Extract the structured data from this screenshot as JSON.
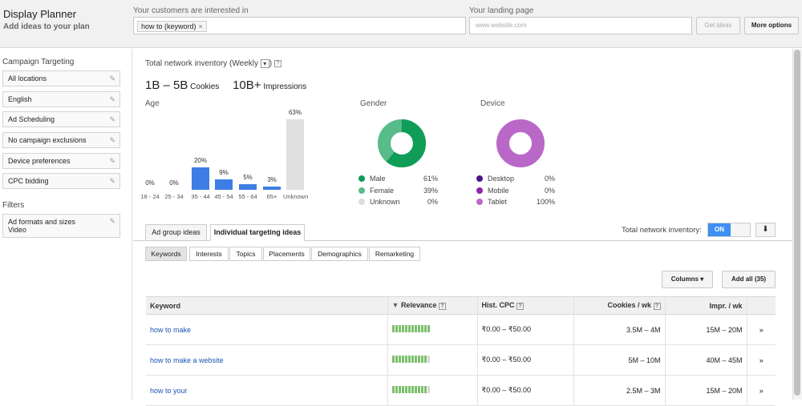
{
  "header": {
    "app_title": "Display Planner",
    "app_subtitle": "Add ideas to your plan",
    "customers_label": "Your customers are interested in",
    "keyword_chip": "how to (keyword)",
    "chip_close": "×",
    "landing_label": "Your landing page",
    "landing_placeholder": "www.website.com",
    "get_ideas": "Get ideas",
    "more_options": "More options"
  },
  "sidebar": {
    "targeting_title": "Campaign Targeting",
    "items": [
      {
        "label": "All locations"
      },
      {
        "label": "English"
      },
      {
        "label": "Ad Scheduling"
      },
      {
        "label": "No campaign exclusions"
      },
      {
        "label": "Device preferences"
      },
      {
        "label": "CPC bidding"
      }
    ],
    "filters_title": "Filters",
    "filter_item_1": "Ad formats and sizes",
    "filter_item_2": "Video"
  },
  "inventory": {
    "title": "Total network inventory (Weekly",
    "dropdown_glyph": "▾",
    "help": "?",
    "cookies_value": "1B – 5B",
    "cookies_label": "Cookies",
    "impressions_value": "10B+",
    "impressions_label": "Impressions"
  },
  "age": {
    "title": "Age",
    "bars": [
      {
        "label": "18 - 24",
        "pct": "0%",
        "value": 0
      },
      {
        "label": "25 - 34",
        "pct": "0%",
        "value": 0
      },
      {
        "label": "35 - 44",
        "pct": "20%",
        "value": 20
      },
      {
        "label": "45 - 54",
        "pct": "9%",
        "value": 9
      },
      {
        "label": "55 - 64",
        "pct": "5%",
        "value": 5
      },
      {
        "label": "65+",
        "pct": "3%",
        "value": 3
      },
      {
        "label": "Unknown",
        "pct": "63%",
        "value": 63
      }
    ]
  },
  "gender": {
    "title": "Gender",
    "items": [
      {
        "label": "Male",
        "pct": "61%",
        "color": "#0f9d58"
      },
      {
        "label": "Female",
        "pct": "39%",
        "color": "#57bb8a"
      },
      {
        "label": "Unknown",
        "pct": "0%",
        "color": "#dddddd"
      }
    ]
  },
  "device": {
    "title": "Device",
    "items": [
      {
        "label": "Desktop",
        "pct": "0%",
        "color": "#4a148c"
      },
      {
        "label": "Mobile",
        "pct": "0%",
        "color": "#8e24aa"
      },
      {
        "label": "Tablet",
        "pct": "100%",
        "color": "#ba68c8"
      }
    ]
  },
  "tabs": {
    "ad_group": "Ad group ideas",
    "individual": "Individual targeting ideas",
    "inventory_toggle_label": "Total network inventory:",
    "toggle_on": "ON",
    "download_glyph": "⬇"
  },
  "subtabs": [
    "Keywords",
    "Interests",
    "Topics",
    "Placements",
    "Demographics",
    "Remarketing"
  ],
  "table": {
    "columns_btn": "Columns ▾",
    "add_all_btn": "Add all (35)",
    "headers": {
      "keyword": "Keyword",
      "sort_glyph": "▼",
      "relevance": "Relevance",
      "hist_cpc": "Hist. CPC",
      "cookies": "Cookies / wk",
      "impr": "Impr. / wk",
      "help": "?"
    },
    "rows": [
      {
        "keyword": "how to make",
        "relevance": 10,
        "cpc": "₹0.00 – ₹50.00",
        "cookies": "3.5M – 4M",
        "impr": "15M – 20M",
        "arrow": "»"
      },
      {
        "keyword": "how to make a website",
        "relevance": 9,
        "cpc": "₹0.00 – ₹50.00",
        "cookies": "5M – 10M",
        "impr": "40M – 45M",
        "arrow": "»"
      },
      {
        "keyword": "how to your",
        "relevance": 9,
        "cpc": "₹0.00 – ₹50.00",
        "cookies": "2.5M – 3M",
        "impr": "15M – 20M",
        "arrow": "»"
      }
    ]
  },
  "colors": {
    "accent": "#3d7de4",
    "toggle": "#3f8ff5",
    "relevance": "#7dc06e"
  }
}
